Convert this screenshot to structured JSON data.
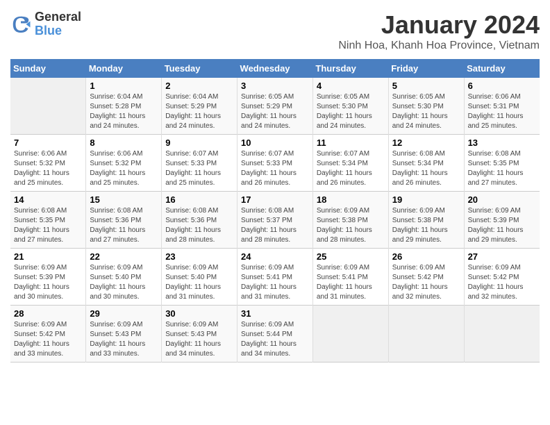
{
  "logo": {
    "line1": "General",
    "line2": "Blue"
  },
  "title": "January 2024",
  "subtitle": "Ninh Hoa, Khanh Hoa Province, Vietnam",
  "days_header": [
    "Sunday",
    "Monday",
    "Tuesday",
    "Wednesday",
    "Thursday",
    "Friday",
    "Saturday"
  ],
  "weeks": [
    [
      {
        "day": "",
        "info": ""
      },
      {
        "day": "1",
        "info": "Sunrise: 6:04 AM\nSunset: 5:28 PM\nDaylight: 11 hours\nand 24 minutes."
      },
      {
        "day": "2",
        "info": "Sunrise: 6:04 AM\nSunset: 5:29 PM\nDaylight: 11 hours\nand 24 minutes."
      },
      {
        "day": "3",
        "info": "Sunrise: 6:05 AM\nSunset: 5:29 PM\nDaylight: 11 hours\nand 24 minutes."
      },
      {
        "day": "4",
        "info": "Sunrise: 6:05 AM\nSunset: 5:30 PM\nDaylight: 11 hours\nand 24 minutes."
      },
      {
        "day": "5",
        "info": "Sunrise: 6:05 AM\nSunset: 5:30 PM\nDaylight: 11 hours\nand 24 minutes."
      },
      {
        "day": "6",
        "info": "Sunrise: 6:06 AM\nSunset: 5:31 PM\nDaylight: 11 hours\nand 25 minutes."
      }
    ],
    [
      {
        "day": "7",
        "info": "Sunrise: 6:06 AM\nSunset: 5:32 PM\nDaylight: 11 hours\nand 25 minutes."
      },
      {
        "day": "8",
        "info": "Sunrise: 6:06 AM\nSunset: 5:32 PM\nDaylight: 11 hours\nand 25 minutes."
      },
      {
        "day": "9",
        "info": "Sunrise: 6:07 AM\nSunset: 5:33 PM\nDaylight: 11 hours\nand 25 minutes."
      },
      {
        "day": "10",
        "info": "Sunrise: 6:07 AM\nSunset: 5:33 PM\nDaylight: 11 hours\nand 26 minutes."
      },
      {
        "day": "11",
        "info": "Sunrise: 6:07 AM\nSunset: 5:34 PM\nDaylight: 11 hours\nand 26 minutes."
      },
      {
        "day": "12",
        "info": "Sunrise: 6:08 AM\nSunset: 5:34 PM\nDaylight: 11 hours\nand 26 minutes."
      },
      {
        "day": "13",
        "info": "Sunrise: 6:08 AM\nSunset: 5:35 PM\nDaylight: 11 hours\nand 27 minutes."
      }
    ],
    [
      {
        "day": "14",
        "info": "Sunrise: 6:08 AM\nSunset: 5:35 PM\nDaylight: 11 hours\nand 27 minutes."
      },
      {
        "day": "15",
        "info": "Sunrise: 6:08 AM\nSunset: 5:36 PM\nDaylight: 11 hours\nand 27 minutes."
      },
      {
        "day": "16",
        "info": "Sunrise: 6:08 AM\nSunset: 5:36 PM\nDaylight: 11 hours\nand 28 minutes."
      },
      {
        "day": "17",
        "info": "Sunrise: 6:08 AM\nSunset: 5:37 PM\nDaylight: 11 hours\nand 28 minutes."
      },
      {
        "day": "18",
        "info": "Sunrise: 6:09 AM\nSunset: 5:38 PM\nDaylight: 11 hours\nand 28 minutes."
      },
      {
        "day": "19",
        "info": "Sunrise: 6:09 AM\nSunset: 5:38 PM\nDaylight: 11 hours\nand 29 minutes."
      },
      {
        "day": "20",
        "info": "Sunrise: 6:09 AM\nSunset: 5:39 PM\nDaylight: 11 hours\nand 29 minutes."
      }
    ],
    [
      {
        "day": "21",
        "info": "Sunrise: 6:09 AM\nSunset: 5:39 PM\nDaylight: 11 hours\nand 30 minutes."
      },
      {
        "day": "22",
        "info": "Sunrise: 6:09 AM\nSunset: 5:40 PM\nDaylight: 11 hours\nand 30 minutes."
      },
      {
        "day": "23",
        "info": "Sunrise: 6:09 AM\nSunset: 5:40 PM\nDaylight: 11 hours\nand 31 minutes."
      },
      {
        "day": "24",
        "info": "Sunrise: 6:09 AM\nSunset: 5:41 PM\nDaylight: 11 hours\nand 31 minutes."
      },
      {
        "day": "25",
        "info": "Sunrise: 6:09 AM\nSunset: 5:41 PM\nDaylight: 11 hours\nand 31 minutes."
      },
      {
        "day": "26",
        "info": "Sunrise: 6:09 AM\nSunset: 5:42 PM\nDaylight: 11 hours\nand 32 minutes."
      },
      {
        "day": "27",
        "info": "Sunrise: 6:09 AM\nSunset: 5:42 PM\nDaylight: 11 hours\nand 32 minutes."
      }
    ],
    [
      {
        "day": "28",
        "info": "Sunrise: 6:09 AM\nSunset: 5:42 PM\nDaylight: 11 hours\nand 33 minutes."
      },
      {
        "day": "29",
        "info": "Sunrise: 6:09 AM\nSunset: 5:43 PM\nDaylight: 11 hours\nand 33 minutes."
      },
      {
        "day": "30",
        "info": "Sunrise: 6:09 AM\nSunset: 5:43 PM\nDaylight: 11 hours\nand 34 minutes."
      },
      {
        "day": "31",
        "info": "Sunrise: 6:09 AM\nSunset: 5:44 PM\nDaylight: 11 hours\nand 34 minutes."
      },
      {
        "day": "",
        "info": ""
      },
      {
        "day": "",
        "info": ""
      },
      {
        "day": "",
        "info": ""
      }
    ]
  ]
}
